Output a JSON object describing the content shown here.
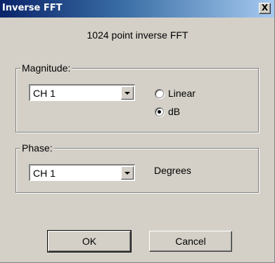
{
  "window": {
    "title": "Inverse FFT",
    "close_glyph": "X"
  },
  "header": {
    "text": "1024  point inverse FFT"
  },
  "magnitude": {
    "label": "Magnitude:",
    "channel": "CH 1",
    "options": [
      {
        "label": "Linear",
        "selected": false
      },
      {
        "label": "dB",
        "selected": true
      }
    ]
  },
  "phase": {
    "label": "Phase:",
    "channel": "CH 1",
    "unit": "Degrees"
  },
  "buttons": {
    "ok": "OK",
    "cancel": "Cancel"
  }
}
